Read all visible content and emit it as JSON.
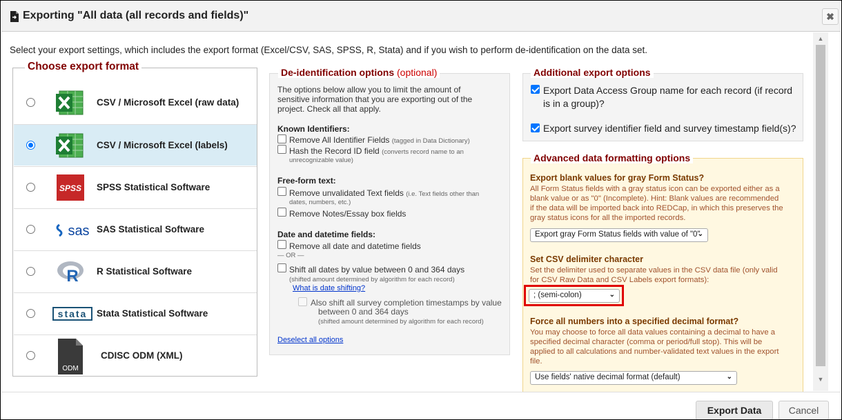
{
  "dialog": {
    "title": "Exporting \"All data (all records and fields)\"",
    "close_label": "✖",
    "intro": "Select your export settings, which includes the export format (Excel/CSV, SAS, SPSS, R, Stata) and if you wish to perform de-identification on the data set."
  },
  "formats": {
    "legend": "Choose export format",
    "items": [
      {
        "label": "CSV / Microsoft Excel (raw data)",
        "icon": "excel-icon",
        "selected": false
      },
      {
        "label": "CSV / Microsoft Excel (labels)",
        "icon": "excel-icon",
        "selected": true
      },
      {
        "label": "SPSS Statistical Software",
        "icon": "spss-icon",
        "icon_text": "SPSS",
        "selected": false
      },
      {
        "label": "SAS Statistical Software",
        "icon": "sas-icon",
        "icon_text": "sas",
        "selected": false
      },
      {
        "label": "R Statistical Software",
        "icon": "r-icon",
        "icon_text": "R",
        "selected": false
      },
      {
        "label": "Stata Statistical Software",
        "icon": "stata-icon",
        "icon_text": "stata",
        "selected": false
      },
      {
        "label": "CDISC ODM (XML)",
        "icon": "odm-file-icon",
        "icon_text": "ODM",
        "selected": false
      }
    ]
  },
  "deid": {
    "legend": "De-identification options",
    "legend_optional": "(optional)",
    "desc": [
      "The options below allow you to limit the amount of",
      "sensitive information that you are exporting out of the",
      "project. Check all that apply."
    ],
    "known_heading": "Known Identifiers:",
    "remove_identifiers": "Remove All Identifier Fields",
    "remove_identifiers_note": "(tagged in Data Dictionary)",
    "hash_record": "Hash the Record ID field",
    "hash_record_note": [
      "(converts record name to an",
      "unrecognizable value)"
    ],
    "freeform_heading": "Free-form text:",
    "remove_unvalidated": "Remove unvalidated Text fields",
    "remove_unvalidated_note": [
      "(i.e. Text fields other than",
      "dates, numbers, etc.)"
    ],
    "remove_notes": "Remove Notes/Essay box fields",
    "date_heading": "Date and datetime fields:",
    "remove_dates": "Remove all date and datetime fields",
    "or": "— OR —",
    "shift_dates": "Shift all dates by value between 0 and 364 days",
    "shift_dates_note": "(shifted amount determined by algorithm for each record)",
    "what_is_shifting": "What is date shifting?",
    "shift_survey": [
      "Also shift all survey completion timestamps by value",
      "between 0 and 364 days"
    ],
    "shift_survey_note": "(shifted amount determined by algorithm for each record)",
    "deselect_all": "Deselect all options"
  },
  "additional": {
    "legend": "Additional export options",
    "dag": [
      "Export Data Access Group name for each record (if record",
      "is in a group)?"
    ],
    "dag_checked": true,
    "survey": "Export survey identifier field and survey timestamp field(s)?",
    "survey_checked": true
  },
  "advanced": {
    "legend": "Advanced data formatting options",
    "blank_heading": "Export blank values for gray Form Status?",
    "blank_desc": [
      "All Form Status fields with a gray status icon can be exported either as a",
      "blank value or as \"0\" (Incomplete). Hint: Blank values are recommended",
      "if the data will be imported back into REDCap, in which this preserves the",
      "gray status icons for all the imported records."
    ],
    "blank_select": "Export gray Form Status fields with value of \"0\"",
    "delim_heading": "Set CSV delimiter character",
    "delim_desc": [
      "Set the delimiter used to separate values in the CSV data file (only valid",
      "for CSV Raw Data and CSV Labels export formats):"
    ],
    "delim_select": "; (semi-colon)",
    "decimal_heading": "Force all numbers into a specified decimal format?",
    "decimal_desc": [
      "You may choose to force all data values containing a decimal to have a",
      "specified decimal character (comma or period/full stop). This will be",
      "applied to all calculations and number-validated text values in the export",
      "file."
    ],
    "decimal_select": "Use fields' native decimal format (default)"
  },
  "footer": {
    "export_label": "Export Data",
    "cancel_label": "Cancel"
  },
  "colors": {
    "legend": "#800000",
    "selected_row": "#d9ecf5",
    "highlight": "#e00000",
    "advanced_bg": "#fff8e1"
  }
}
